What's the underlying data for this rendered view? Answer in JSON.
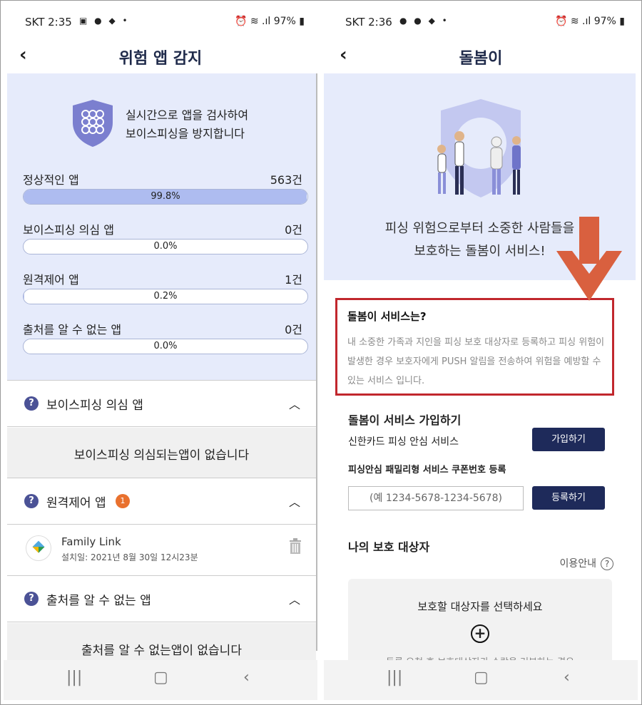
{
  "left": {
    "status": {
      "time": "SKT 2:35",
      "battery": "97%"
    },
    "title": "위험 앱 감지",
    "intro": [
      "실시간으로 앱을 검사하여",
      "보이스피싱을 방지합니다"
    ],
    "stats": [
      {
        "label": "정상적인 앱",
        "count": "563건",
        "pct_text": "99.8%",
        "fill": 0.998
      },
      {
        "label": "보이스피싱 의심 앱",
        "count": "0건",
        "pct_text": "0.0%",
        "fill": 0.0
      },
      {
        "label": "원격제어 앱",
        "count": "1건",
        "pct_text": "0.2%",
        "fill": 0.002
      },
      {
        "label": "출처를 알 수 없는 앱",
        "count": "0건",
        "pct_text": "0.0%",
        "fill": 0.0
      }
    ],
    "sections": [
      {
        "title": "보이스피싱 의심 앱",
        "body": "보이스피싱 의심되는앱이 없습니다"
      },
      {
        "title": "원격제어 앱",
        "badge": "1"
      },
      {
        "title": "출처를 알 수 없는 앱",
        "body": "출처를 알 수 없는앱이 없습니다"
      }
    ],
    "remote_app": {
      "name": "Family Link",
      "installed": "설치일: 2021년 8월 30일 12시23분"
    }
  },
  "right": {
    "status": {
      "time": "SKT 2:36",
      "battery": "97%"
    },
    "title": "돌봄이",
    "hero": [
      "피싱 위험으로부터 소중한 사람들을",
      "보호하는 돌봄이 서비스!"
    ],
    "service": {
      "title": "돌봄이 서비스는?",
      "desc": "내 소중한 가족과 지인을 피싱 보호 대상자로 등록하고 피싱 위험이 발생한 경우 보호자에게 PUSH 알림을 전송하여 위험을 예방할 수 있는 서비스 입니다."
    },
    "join": {
      "title": "돌봄이 서비스 가입하기",
      "sub": "신한카드 피싱 안심 서비스",
      "join_btn": "가입하기",
      "coupon_title": "피싱안심 패밀리형 서비스 쿠폰번호 등록",
      "coupon_placeholder": "(예 1234-5678-1234-5678)",
      "register_btn": "등록하기"
    },
    "protect": {
      "title": "나의 보호 대상자",
      "guide": "이용안내",
      "select": "보호할 대상자를 선택하세요",
      "note": "등록 요청 후 보호대상자가 수락을 거부하는 경우"
    }
  },
  "colors": {
    "accent": "#1e2a5a",
    "panel": "#e6ebfb",
    "bar_fill": "#aebcf0",
    "highlight": "#c1272d",
    "arrow": "#d9603f",
    "badge": "#e9712e"
  }
}
